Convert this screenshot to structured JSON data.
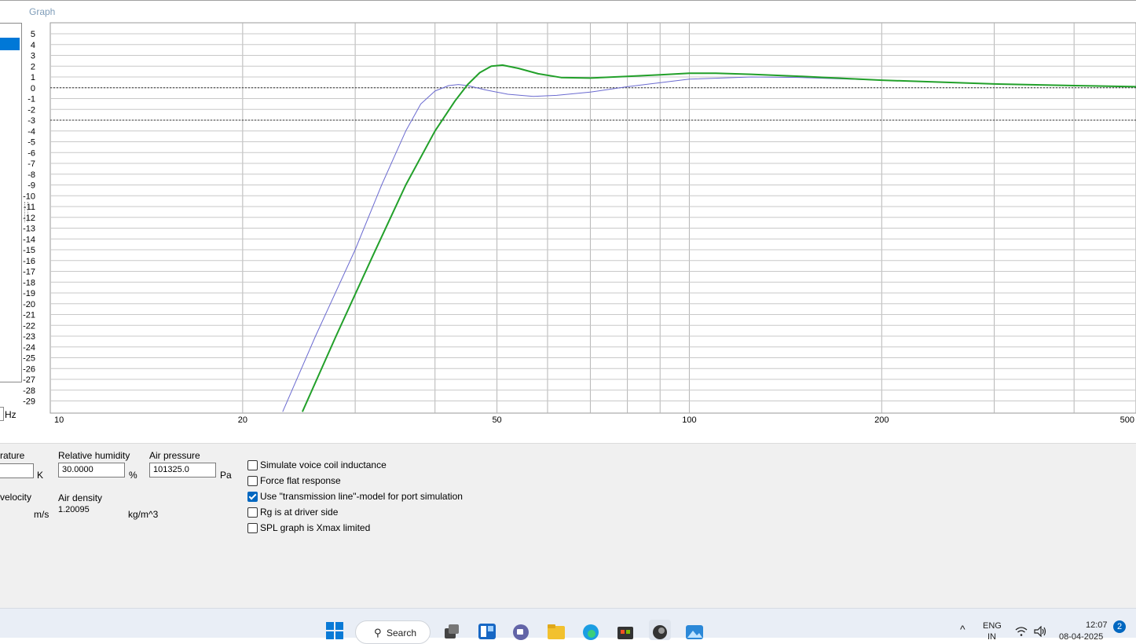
{
  "graph": {
    "caption": "Graph",
    "x_unit_label": "Hz"
  },
  "chart_data": {
    "type": "line",
    "x_scale": "log",
    "xlim": [
      10,
      500
    ],
    "ylim": [
      -30,
      6
    ],
    "x_ticks": [
      "10",
      "20",
      "50",
      "100",
      "200",
      "500"
    ],
    "y_ticks": [
      "5",
      "4",
      "3",
      "2",
      "1",
      "0",
      "-1",
      "-2",
      "-3",
      "-4",
      "-5",
      "-6",
      "-7",
      "-8",
      "-9",
      "-10",
      "-11",
      "-12",
      "-13",
      "-14",
      "-15",
      "-16",
      "-17",
      "-18",
      "-19",
      "-20",
      "-21",
      "-22",
      "-23",
      "-24",
      "-25",
      "-26",
      "-27",
      "-28",
      "-29"
    ],
    "reference_lines": [
      0,
      -3
    ],
    "grid": true,
    "series": [
      {
        "color": "#6a6ad0",
        "x": [
          23.1,
          26,
          30,
          33,
          36,
          38,
          40,
          42,
          43.5,
          45,
          48,
          52,
          57,
          62,
          70,
          80,
          100,
          125,
          150,
          200,
          300,
          400,
          500
        ],
        "y": [
          -30,
          -23,
          -15,
          -9,
          -4,
          -1.5,
          -0.3,
          0.2,
          0.3,
          0.2,
          -0.2,
          -0.6,
          -0.8,
          -0.7,
          -0.4,
          0.1,
          0.8,
          1.0,
          0.95,
          0.7,
          0.35,
          0.2,
          0.1
        ]
      },
      {
        "color": "#22a02a",
        "x": [
          24.8,
          28,
          32,
          36,
          40,
          43,
          45,
          47,
          49,
          51,
          54,
          58,
          63,
          70,
          80,
          90,
          100,
          110,
          125,
          150,
          200,
          300,
          400,
          500
        ],
        "y": [
          -30,
          -23,
          -15.5,
          -9,
          -4,
          -1.2,
          0.3,
          1.4,
          2.0,
          2.1,
          1.8,
          1.3,
          0.95,
          0.9,
          1.05,
          1.2,
          1.35,
          1.35,
          1.25,
          1.05,
          0.7,
          0.35,
          0.2,
          0.1
        ]
      }
    ]
  },
  "left_panel": {
    "hz_label": "Hz"
  },
  "environment": {
    "temperature_label": "rature",
    "temperature_unit": "K",
    "humidity_label": "Relative humidity",
    "humidity_value": "30.0000",
    "humidity_unit": "%",
    "pressure_label": "Air pressure",
    "pressure_value": "101325.0",
    "pressure_unit": "Pa",
    "velocity_label": "velocity",
    "velocity_unit": "m/s",
    "density_label": "Air density",
    "density_value": "1.20095",
    "density_unit": "kg/m^3"
  },
  "options": [
    {
      "label": "Simulate voice coil inductance",
      "checked": false
    },
    {
      "label": "Force flat response",
      "checked": false
    },
    {
      "label": "Use \"transmission line\"-model for port simulation",
      "checked": true
    },
    {
      "label": "Rg is at driver side",
      "checked": false
    },
    {
      "label": "SPL graph is Xmax limited",
      "checked": false
    }
  ],
  "taskbar": {
    "search_label": "Search",
    "language": "ENG",
    "language_sub": "IN",
    "time": "12:07",
    "date": "08-04-2025",
    "notification_count": "2"
  }
}
